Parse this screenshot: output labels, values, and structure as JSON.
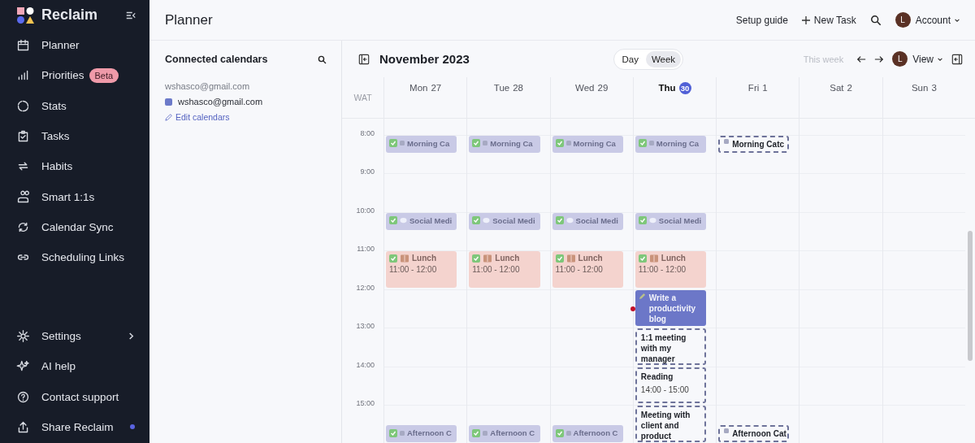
{
  "sidebar": {
    "brand": "Reclaim",
    "items": [
      {
        "label": "Planner"
      },
      {
        "label": "Priorities",
        "badge": "Beta"
      },
      {
        "label": "Stats"
      },
      {
        "label": "Tasks"
      },
      {
        "label": "Habits"
      },
      {
        "label": "Smart 1:1s"
      },
      {
        "label": "Calendar Sync"
      },
      {
        "label": "Scheduling Links"
      }
    ],
    "bottom_items": [
      {
        "label": "Settings",
        "submenu": true,
        "notification": false
      },
      {
        "label": "AI help",
        "submenu": false,
        "notification": false
      },
      {
        "label": "Contact support",
        "submenu": false,
        "notification": false
      },
      {
        "label": "Share Reclaim",
        "submenu": false,
        "notification": true
      }
    ]
  },
  "header": {
    "title": "Planner",
    "setup_guide": "Setup guide",
    "new_task": "New Task",
    "avatar": "L",
    "account": "Account"
  },
  "calendars_panel": {
    "title": "Connected calendars",
    "account": "wshasco@gmail.com",
    "calendars": [
      {
        "name": "wshasco@gmail.com",
        "color": "#6c7ac9"
      }
    ],
    "edit_link": "Edit calendars"
  },
  "calendar": {
    "month": "November 2023",
    "views": [
      {
        "label": "Day",
        "selected": false
      },
      {
        "label": "Week",
        "selected": true
      }
    ],
    "this_week": "This week",
    "view_avatar": "L",
    "view": "View",
    "timezone": "WAT",
    "hours": [
      "8:00",
      "9:00",
      "10:00",
      "11:00",
      "12:00",
      "13:00",
      "14:00",
      "15:00"
    ],
    "days": [
      {
        "name": "Mon",
        "date": "27",
        "today": false,
        "events": [
          {
            "kind": "morning",
            "confirmed": true,
            "title": "Morning Ca"
          },
          {
            "kind": "social",
            "confirmed": true,
            "title": "Social Medi"
          },
          {
            "kind": "lunch",
            "confirmed": true,
            "title": "Lunch",
            "time": "11:00 - 12:00"
          },
          {
            "kind": "afternoon",
            "confirmed": true,
            "title": "Afternoon C"
          }
        ]
      },
      {
        "name": "Tue",
        "date": "28",
        "today": false,
        "events": [
          {
            "kind": "morning",
            "confirmed": true,
            "title": "Morning Ca"
          },
          {
            "kind": "social",
            "confirmed": true,
            "title": "Social Medi"
          },
          {
            "kind": "lunch",
            "confirmed": true,
            "title": "Lunch",
            "time": "11:00 - 12:00"
          },
          {
            "kind": "afternoon",
            "confirmed": true,
            "title": "Afternoon C"
          }
        ]
      },
      {
        "name": "Wed",
        "date": "29",
        "today": false,
        "events": [
          {
            "kind": "morning",
            "confirmed": true,
            "title": "Morning Ca"
          },
          {
            "kind": "social",
            "confirmed": true,
            "title": "Social Medi"
          },
          {
            "kind": "lunch",
            "confirmed": true,
            "title": "Lunch",
            "time": "11:00 - 12:00"
          },
          {
            "kind": "afternoon",
            "confirmed": true,
            "title": "Afternoon C"
          }
        ]
      },
      {
        "name": "Thu",
        "date": "30",
        "today": true,
        "events": [
          {
            "kind": "morning",
            "confirmed": true,
            "title": "Morning Ca"
          },
          {
            "kind": "social",
            "confirmed": true,
            "title": "Social Medi"
          },
          {
            "kind": "lunch",
            "confirmed": true,
            "title": "Lunch",
            "time": "11:00 - 12:00"
          },
          {
            "kind": "writing",
            "confirmed": true,
            "title": "Write a productivity blog"
          },
          {
            "kind": "oneonone",
            "confirmed": false,
            "title": "1:1 meeting with my manager"
          },
          {
            "kind": "reading",
            "confirmed": false,
            "title": "Reading",
            "time": "14:00 - 15:00"
          },
          {
            "kind": "client",
            "confirmed": false,
            "title": "Meeting with client and product"
          }
        ]
      },
      {
        "name": "Fri",
        "date": "1",
        "today": false,
        "events": [
          {
            "kind": "morning",
            "confirmed": false,
            "title": "Morning Catc"
          },
          {
            "kind": "afternoon",
            "confirmed": false,
            "title": "Afternoon Cat"
          }
        ]
      },
      {
        "name": "Sat",
        "date": "2",
        "today": false
      },
      {
        "name": "Sun",
        "date": "3",
        "today": false
      }
    ]
  }
}
